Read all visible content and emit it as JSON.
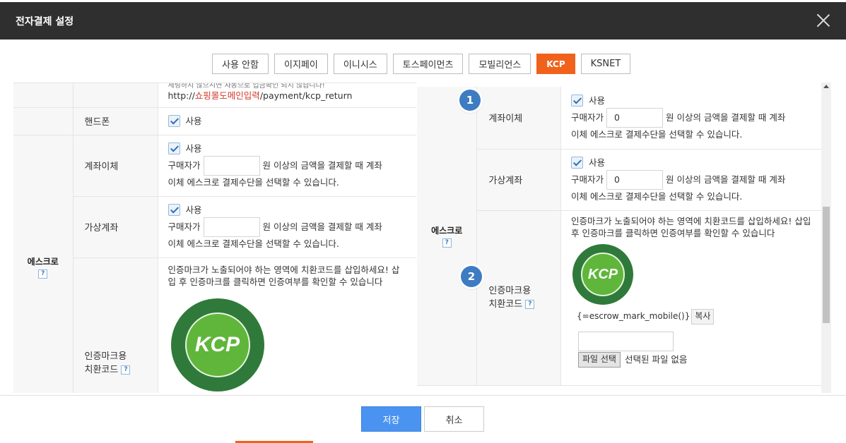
{
  "window": {
    "title": "전자결제 설정"
  },
  "tabs": [
    {
      "label": "사용 안함"
    },
    {
      "label": "이지페이"
    },
    {
      "label": "이니시스"
    },
    {
      "label": "토스페이먼츠"
    },
    {
      "label": "모빌리언스"
    },
    {
      "label": "KCP"
    },
    {
      "label": "KSNET"
    }
  ],
  "left": {
    "cut_text": "세팅하지 않으시면 자동으로 입금확인 되지 않습니다!",
    "url_prefix": "http://",
    "url_highlight": "쇼핑몰도메인입력",
    "url_suffix": "/payment/kcp_return",
    "phone": {
      "label": "핸드폰",
      "use": "사용"
    },
    "escrow_group": "에스크로",
    "account": {
      "label": "계좌이체",
      "use": "사용",
      "pre": "구매자가",
      "value": "",
      "post": "원 이상의 금액을 결제할 때 계좌",
      "line2": "이체 에스크로 결제수단을 선택할 수 있습니다."
    },
    "virtual": {
      "label": "가상계좌",
      "use": "사용",
      "pre": "구매자가",
      "value": "",
      "post": "원 이상의 금액을 결제할 때 계좌",
      "line2": "이체 에스크로 결제수단을 선택할 수 있습니다."
    },
    "mark": {
      "label1": "인증마크용",
      "label2": "치환코드",
      "desc": "인증마크가 노출되어야 하는 영역에 치환코드를 삽입하세요! 삽입 후 인증마크를 클릭하면 인증여부를 확인할 수 있습니다",
      "seal_text": "KCP"
    }
  },
  "right": {
    "escrow_group": "에스크로",
    "account": {
      "label": "계좌이체",
      "use": "사용",
      "pre": "구매자가",
      "value": "0",
      "post": "원 이상의 금액을 결제할 때 계좌",
      "line2": "이체 에스크로 결제수단을 선택할 수 있습니다."
    },
    "virtual": {
      "label": "가상계좌",
      "use": "사용",
      "pre": "구매자가",
      "value": "0",
      "post": "원 이상의 금액을 결제할 때 계좌",
      "line2": "이체 에스크로 결제수단을 선택할 수 있습니다."
    },
    "mark": {
      "label1": "인증마크용",
      "label2": "치환코드",
      "desc": "인증마크가 노출되어야 하는 영역에 치환코드를 삽입하세요! 삽입 후 인증마크를 클릭하면 인증여부를 확인할 수 있습니다",
      "seal_text": "KCP",
      "code": "{=escrow_mark_mobile()}",
      "copy": "복사",
      "file_btn": "파일 선택",
      "file_status": "선택된 파일 없음"
    }
  },
  "badges": {
    "one": "1",
    "two": "2"
  },
  "help_glyph": "?",
  "footer": {
    "save": "저장",
    "cancel": "취소"
  },
  "colors": {
    "accent": "#f0621c",
    "primary": "#4b93f0",
    "badge": "#3e7cc2",
    "header": "#2f2f2f"
  }
}
